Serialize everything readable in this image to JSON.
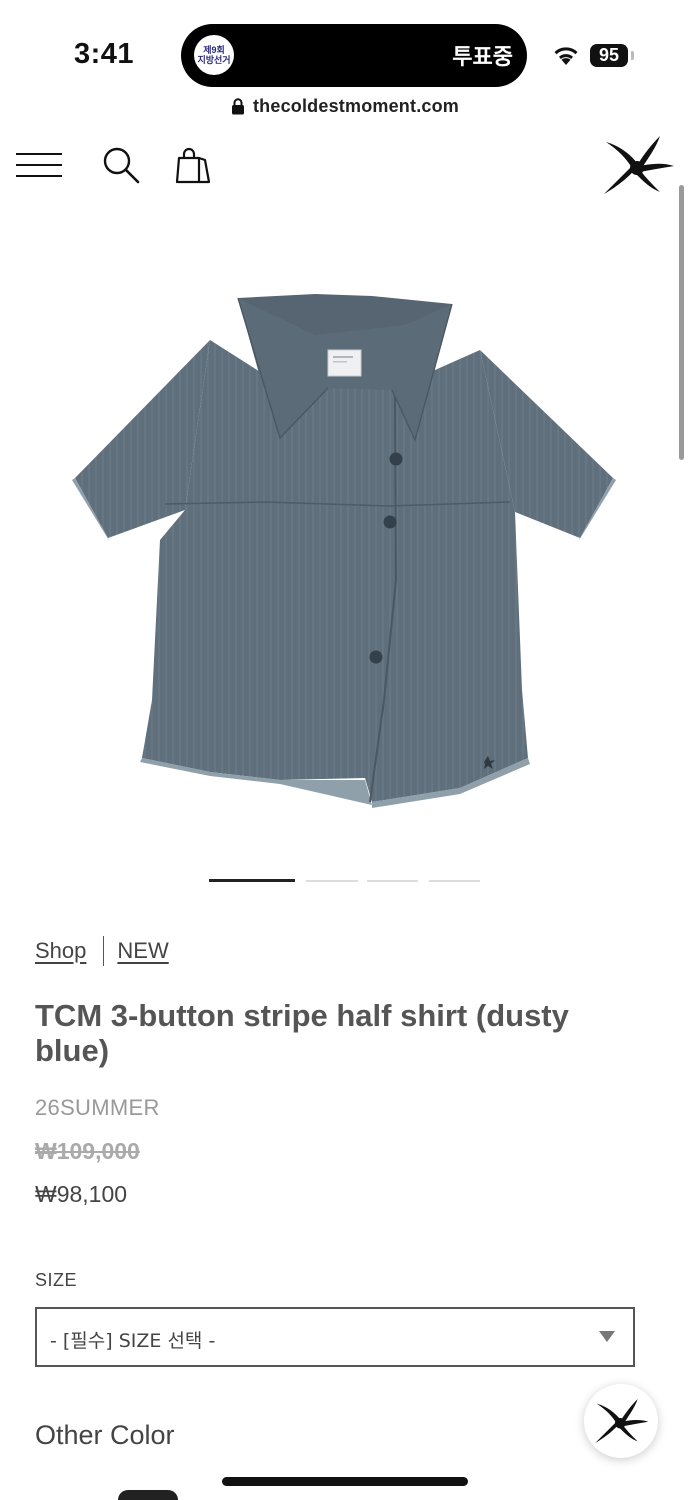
{
  "status_bar": {
    "time": "3:41",
    "badge_line1": "제9회",
    "badge_line2": "지방선거",
    "island_text": "투표중",
    "battery": "95"
  },
  "url_bar": {
    "url": "thecoldestmoment.com"
  },
  "header": {
    "icons": [
      "menu-icon",
      "search-icon",
      "bag-icon",
      "starfish-logo"
    ]
  },
  "product": {
    "image_alt": "dusty blue stripe half shirt",
    "carousel": {
      "count": 4,
      "active_index": 0
    },
    "breadcrumb": [
      "Shop",
      "NEW"
    ],
    "title": "TCM 3-button stripe half shirt (dusty blue)",
    "season": "26SUMMER",
    "price_original": "₩109,000",
    "price_sale": "₩98,100"
  },
  "options": {
    "size_label": "SIZE",
    "size_placeholder": "- [필수] SIZE 선택 -"
  },
  "other_color": {
    "heading": "Other Color"
  },
  "colors": {
    "shirt": "#5f6f7c",
    "text": "#555555",
    "muted": "#999999"
  }
}
